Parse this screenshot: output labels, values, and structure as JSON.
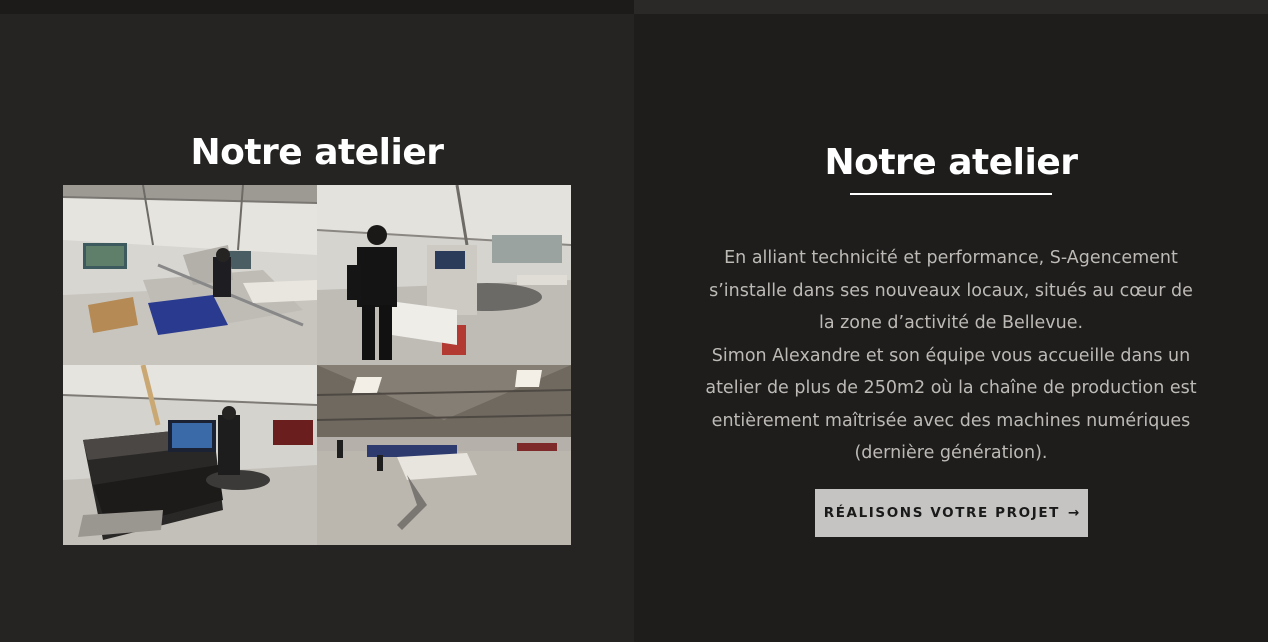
{
  "left_panel": {
    "title": "Notre atelier",
    "gallery": [
      {
        "name": "workshop-photo-panel-saw"
      },
      {
        "name": "workshop-photo-cnc-operator"
      },
      {
        "name": "workshop-photo-edgebander"
      },
      {
        "name": "workshop-photo-hall-overview"
      }
    ]
  },
  "right_panel": {
    "title": "Notre atelier",
    "paragraph_lines": [
      "En alliant technicité et performance, S-Agencement",
      "s’installe dans ses nouveaux locaux, situés au cœur de",
      "la zone d’activité de Bellevue.",
      "Simon Alexandre et son équipe vous accueille dans un",
      "atelier de plus de 250m2 où la chaîne de production est",
      "entièrement maîtrisée avec des machines numériques",
      "(dernière génération)."
    ],
    "cta": {
      "label": "RÉALISONS VOTRE PROJET",
      "arrow": "→"
    }
  },
  "colors": {
    "left_bg": "#252423",
    "right_bg": "#1e1d1c",
    "title": "#ffffff",
    "body_text": "#bdbab6",
    "button_bg": "#c5c4c2",
    "button_text": "#1a1a1a"
  }
}
